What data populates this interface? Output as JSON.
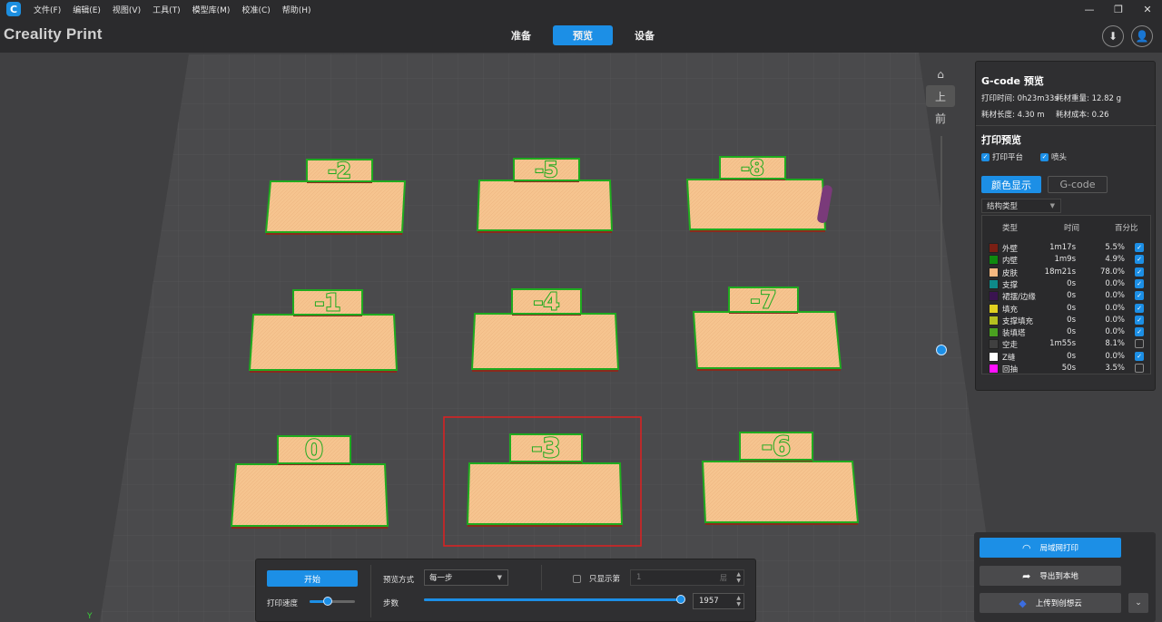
{
  "app": {
    "logo_glyph": "C",
    "brand": "Creality Print",
    "menu": [
      "文件(F)",
      "编辑(E)",
      "视图(V)",
      "工具(T)",
      "模型库(M)",
      "校准(C)",
      "帮助(H)"
    ],
    "window_controls": [
      "—",
      "❐",
      "✕"
    ]
  },
  "tabs": [
    {
      "label": "准备",
      "active": false
    },
    {
      "label": "预览",
      "active": true
    },
    {
      "label": "设备",
      "active": false
    }
  ],
  "top_icons": {
    "download": "⬇",
    "account": "👤"
  },
  "scene": {
    "models": [
      "-2",
      "-5",
      "-8",
      "-1",
      "-4",
      "-7",
      "0",
      "-3",
      "-6"
    ],
    "selected_model": "-3",
    "colors": {
      "skin": "#f6c48f",
      "outer_wall": "#8a2a1c",
      "inner_wall": "#1faa1f",
      "bed": "#4a4a4c",
      "selection": "#e02020"
    }
  },
  "view_tools": {
    "home": "⌂",
    "layer_view": "上",
    "front_view": "前"
  },
  "gcode_panel": {
    "title": "G-code 预览",
    "print_time_label": "打印时间:",
    "print_time": "0h23m33s",
    "weight_label": "耗材重量:",
    "weight": "12.82 g",
    "length_label": "耗材长度:",
    "length": "4.30 m",
    "cost_label": "耗材成本:",
    "cost": "0.26",
    "print_preview_title": "打印预览",
    "show_bed": "打印平台",
    "show_nozzle": "喷头",
    "color_display_btn": "颜色显示",
    "gcode_btn": "G-code",
    "struct_select": "结构类型",
    "legend_headers": {
      "type": "类型",
      "time": "时间",
      "percent": "百分比"
    },
    "legend": [
      {
        "name": "外壁",
        "time": "1m17s",
        "percent": "5.5%",
        "color": "#7a1f14",
        "checked": true
      },
      {
        "name": "内壁",
        "time": "1m9s",
        "percent": "4.9%",
        "color": "#0f8a0f",
        "checked": true
      },
      {
        "name": "皮肤",
        "time": "18m21s",
        "percent": "78.0%",
        "color": "#f6b880",
        "checked": true
      },
      {
        "name": "支撑",
        "time": "0s",
        "percent": "0.0%",
        "color": "#0e8a8a",
        "checked": true
      },
      {
        "name": "裙摆/边缘",
        "time": "0s",
        "percent": "0.0%",
        "color": "#3a1450",
        "checked": true
      },
      {
        "name": "填充",
        "time": "0s",
        "percent": "0.0%",
        "color": "#e0d020",
        "checked": true
      },
      {
        "name": "支撑填充",
        "time": "0s",
        "percent": "0.0%",
        "color": "#b4c020",
        "checked": true
      },
      {
        "name": "装填塔",
        "time": "0s",
        "percent": "0.0%",
        "color": "#4aa020",
        "checked": true
      },
      {
        "name": "空走",
        "time": "1m55s",
        "percent": "8.1%",
        "color": "#404040",
        "checked": false
      },
      {
        "name": "Z缝",
        "time": "0s",
        "percent": "0.0%",
        "color": "#ffffff",
        "checked": true
      },
      {
        "name": "回抽",
        "time": "50s",
        "percent": "3.5%",
        "color": "#ff10ff",
        "checked": false
      }
    ]
  },
  "bottom": {
    "start_btn": "开始",
    "speed_label": "打印速度",
    "speed_value": 0.4,
    "preview_mode_label": "预览方式",
    "preview_mode": "每一步",
    "only_show_label": "只显示第",
    "only_show_value": "1",
    "layer_unit": "层",
    "steps_label": "步数",
    "steps_value": "1957",
    "steps_fraction": 1.0
  },
  "actions": {
    "lan_print": "局域网打印",
    "export_local": "导出到本地",
    "upload_cloud": "上传到创想云",
    "more": "⌄"
  },
  "axis_glyph": "Y"
}
